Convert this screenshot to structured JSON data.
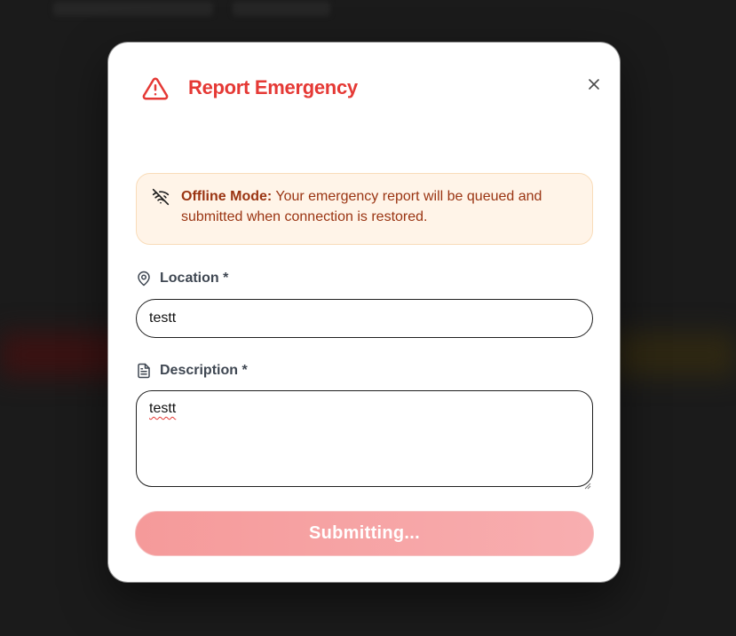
{
  "modal": {
    "title": "Report Emergency",
    "header_icon": "warning-triangle-icon",
    "close_icon": "close-icon",
    "accent_color": "#e53935"
  },
  "alert": {
    "icon": "wifi-off-icon",
    "label": "Offline Mode:",
    "message": " Your emergency report will be queued and submitted when connection is restored.",
    "background_color": "#fff4e8",
    "text_color": "#9a3412"
  },
  "location": {
    "label": "Location *",
    "icon": "map-pin-icon",
    "value": "testt"
  },
  "description": {
    "label": "Description *",
    "icon": "document-icon",
    "value": "testt"
  },
  "submit": {
    "label": "Submitting...",
    "state": "disabled"
  }
}
